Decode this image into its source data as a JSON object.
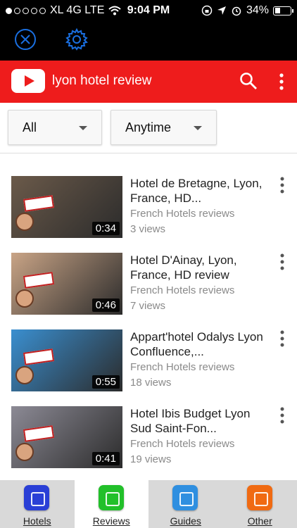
{
  "status_bar": {
    "carrier": "XL 4G LTE",
    "time": "9:04 PM",
    "battery": "34%",
    "battery_level": 0.34
  },
  "app_toolbar": {
    "icons": [
      "close-circle-icon",
      "gear-icon"
    ]
  },
  "youtube_bar": {
    "logo": "youtube-logo",
    "query": "lyon hotel review",
    "icons": [
      "search-icon",
      "more-vertical-icon"
    ]
  },
  "filters": {
    "type": "All",
    "date": "Anytime"
  },
  "videos": [
    {
      "title": "Hotel de Bretagne, Lyon, France, HD...",
      "channel": "French Hotels reviews",
      "views": "3 views",
      "duration": "0:34",
      "thumb_color": "#6b5a4a"
    },
    {
      "title": "Hotel D'Ainay, Lyon, France, HD review",
      "channel": "French Hotels reviews",
      "views": "7 views",
      "duration": "0:46",
      "thumb_color": "#c9a486"
    },
    {
      "title": "Appart'hotel Odalys Lyon Confluence,...",
      "channel": "French Hotels reviews",
      "views": "18 views",
      "duration": "0:55",
      "thumb_color": "#3a8fd0"
    },
    {
      "title": "Hotel Ibis Budget Lyon Sud Saint-Fon...",
      "channel": "French Hotels reviews",
      "views": "19 views",
      "duration": "0:41",
      "thumb_color": "#8c8a95"
    }
  ],
  "tabs": [
    {
      "label": "Hotels",
      "color": "#2a3fd6",
      "active": false
    },
    {
      "label": "Reviews",
      "color": "#22c02a",
      "active": true
    },
    {
      "label": "Guides",
      "color": "#2f8fe0",
      "active": false
    },
    {
      "label": "Other",
      "color": "#f06a12",
      "active": false
    }
  ],
  "colors": {
    "youtube_red": "#ee1c1c",
    "toolbar_icon_blue": "#1a6fe0"
  }
}
